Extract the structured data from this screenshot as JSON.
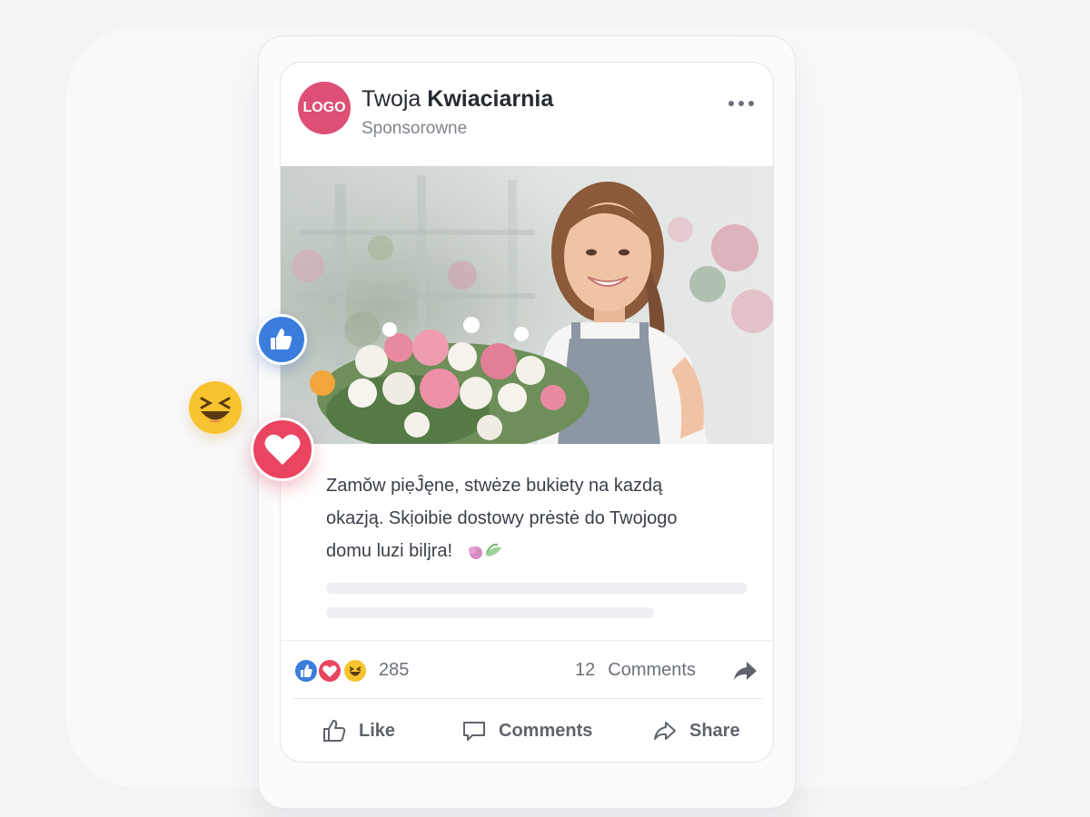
{
  "post": {
    "logo_text": "LOGO",
    "page_name_prefix": "Twoja",
    "page_name_bold": "Kwiaciarnia",
    "sponsored_label": "Sponsorowne",
    "more_icon": "more-horizontal-icon",
    "image_alt": "florist-holding-bouquet-photo",
    "text_line1": "Zamŏw piẹĴęne, stwėze bukiety na kazdą",
    "text_line2": "okazją. Skịoibie dostowy prėstė do Twojogo",
    "text_line3": "domu luzi biǉra!",
    "text_emoji": "flower-emoji"
  },
  "stats": {
    "reaction_icons": [
      "like-icon",
      "love-icon",
      "laugh-icon"
    ],
    "reaction_count": "285",
    "comment_count": "12",
    "comments_label": "Comments"
  },
  "actions": {
    "like_label": "Like",
    "comments_label": "Comments",
    "share_label": "Share"
  },
  "floating_reactions": [
    "like-icon",
    "laugh-icon",
    "love-icon"
  ],
  "colors": {
    "logo": "#dd4f74",
    "like_blue": "#3b7ddd",
    "love_red": "#e94560",
    "laugh_yellow": "#f7c32e"
  }
}
